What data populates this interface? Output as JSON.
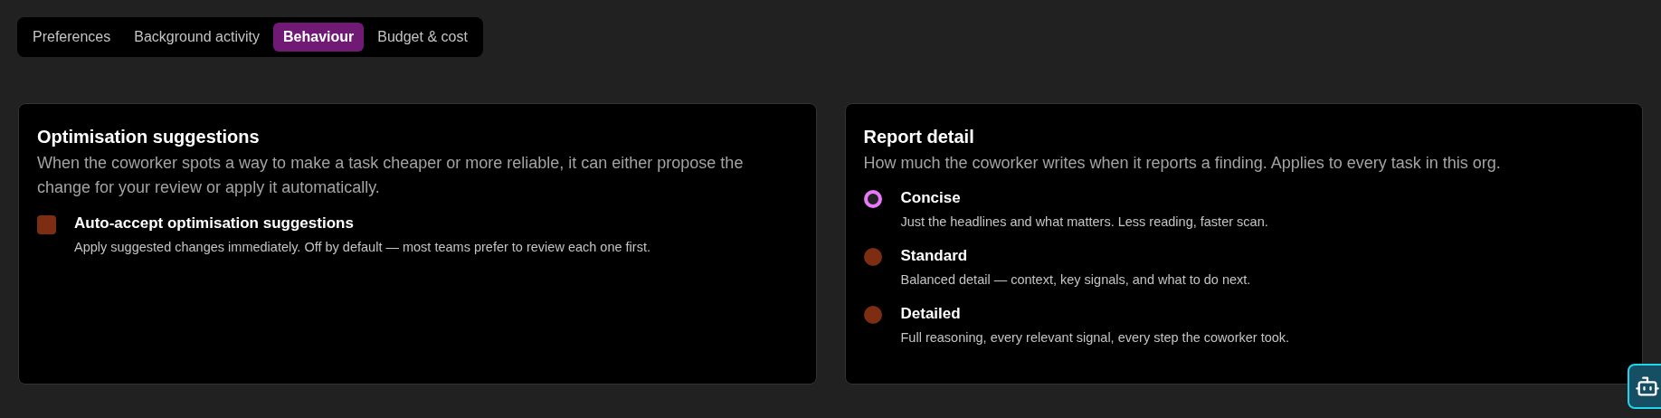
{
  "tabs": [
    {
      "label": "Preferences",
      "selected": false
    },
    {
      "label": "Background activity",
      "selected": false
    },
    {
      "label": "Behaviour",
      "selected": true
    },
    {
      "label": "Budget & cost",
      "selected": false
    }
  ],
  "optimisation": {
    "title": "Optimisation suggestions",
    "description": "When the coworker spots a way to make a task cheaper or more reliable, it can either propose the change for your review or apply it automatically.",
    "checkbox": {
      "label": "Auto-accept optimisation suggestions",
      "hint": "Apply suggested changes immediately. Off by default — most teams prefer to review each one first.",
      "checked": false
    }
  },
  "report_detail": {
    "title": "Report detail",
    "description": "How much the coworker writes when it reports a finding. Applies to every task in this org.",
    "options": [
      {
        "label": "Concise",
        "hint": "Just the headlines and what matters. Less reading, faster scan.",
        "selected": true
      },
      {
        "label": "Standard",
        "hint": "Balanced detail — context, key signals, and what to do next.",
        "selected": false
      },
      {
        "label": "Detailed",
        "hint": "Full reasoning, every relevant signal, every step the coworker took.",
        "selected": false
      }
    ]
  }
}
